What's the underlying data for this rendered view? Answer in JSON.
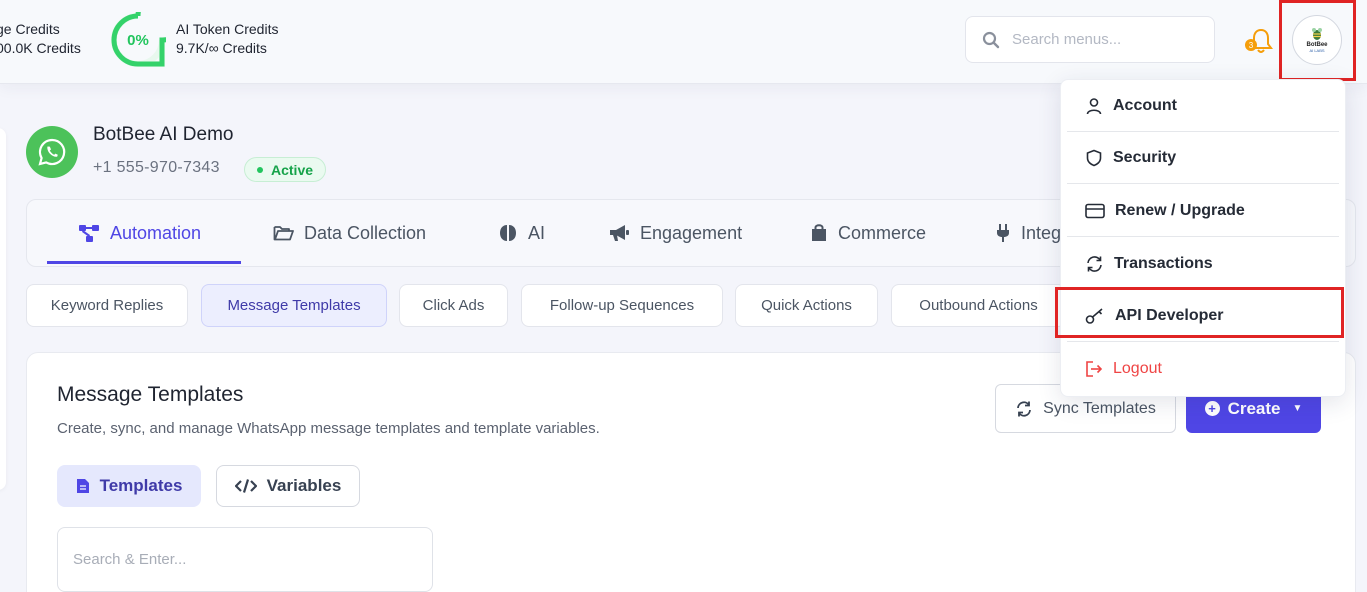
{
  "header": {
    "credits_left": {
      "title": "ge Credits",
      "value": "00.0K Credits"
    },
    "gauge": {
      "percent_label": "0%",
      "percent": 0,
      "color": "#22c55e"
    },
    "credits_right": {
      "title": "AI Token Credits",
      "value": "9.7K/∞ Credits"
    },
    "search": {
      "placeholder": "Search menus..."
    },
    "notifications": {
      "badge": "3",
      "icon": "bell-icon"
    },
    "avatar": {
      "brand": "BotBee",
      "brand_sub": "AI LABS"
    }
  },
  "account": {
    "name": "BotBee AI Demo",
    "phone": "+1 555-970-7343",
    "status": "Active",
    "status_color": "#16a34a"
  },
  "main_tabs": [
    {
      "label": "Automation",
      "icon": "automation-icon",
      "active": true
    },
    {
      "label": "Data Collection",
      "icon": "folder-icon"
    },
    {
      "label": "AI",
      "icon": "brain-icon"
    },
    {
      "label": "Engagement",
      "icon": "megaphone-icon"
    },
    {
      "label": "Commerce",
      "icon": "shopping-bag-icon"
    },
    {
      "label": "Integ",
      "icon": "plug-icon"
    }
  ],
  "sub_tabs": [
    {
      "label": "Keyword Replies"
    },
    {
      "label": "Message Templates",
      "active": true
    },
    {
      "label": "Click Ads"
    },
    {
      "label": "Follow-up Sequences"
    },
    {
      "label": "Quick Actions"
    },
    {
      "label": "Outbound Actions"
    }
  ],
  "panel": {
    "title": "Message Templates",
    "subtitle": "Create, sync, and manage WhatsApp message templates and template variables.",
    "sync_button": "Sync Templates",
    "create_button": "Create",
    "segments": {
      "templates": "Templates",
      "variables": "Variables"
    },
    "search_placeholder": "Search & Enter..."
  },
  "dropdown": {
    "items": [
      {
        "label": "Account",
        "icon": "user-icon"
      },
      {
        "label": "Security",
        "icon": "shield-icon"
      },
      {
        "label": "Renew / Upgrade",
        "icon": "credit-card-icon"
      },
      {
        "label": "Transactions",
        "icon": "refresh-icon"
      },
      {
        "label": "API Developer",
        "icon": "key-icon",
        "highlighted": true
      },
      {
        "label": "Logout",
        "icon": "logout-icon",
        "color": "#ef4444"
      }
    ]
  },
  "colors": {
    "accent": "#4f46e5",
    "highlight": "#e02424",
    "whatsapp": "#4cc25a"
  }
}
